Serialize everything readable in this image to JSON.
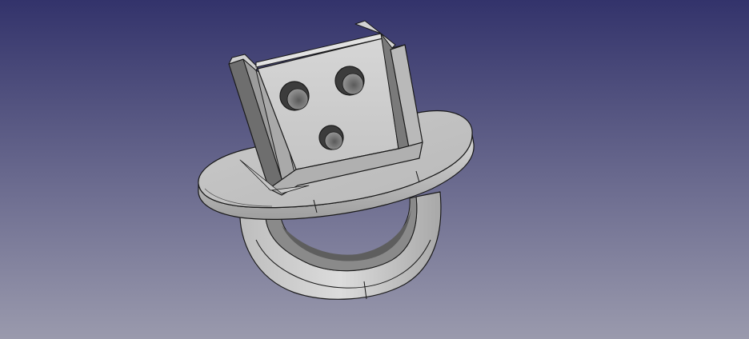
{
  "viewport": {
    "background_top": "#33336b",
    "background_bottom": "#9a9aad",
    "model_face_light": "#d2d2d2",
    "model_face_mid": "#b4b4b4",
    "model_face_dark": "#6e6e6e",
    "model_edge": "#1a1a1a"
  }
}
